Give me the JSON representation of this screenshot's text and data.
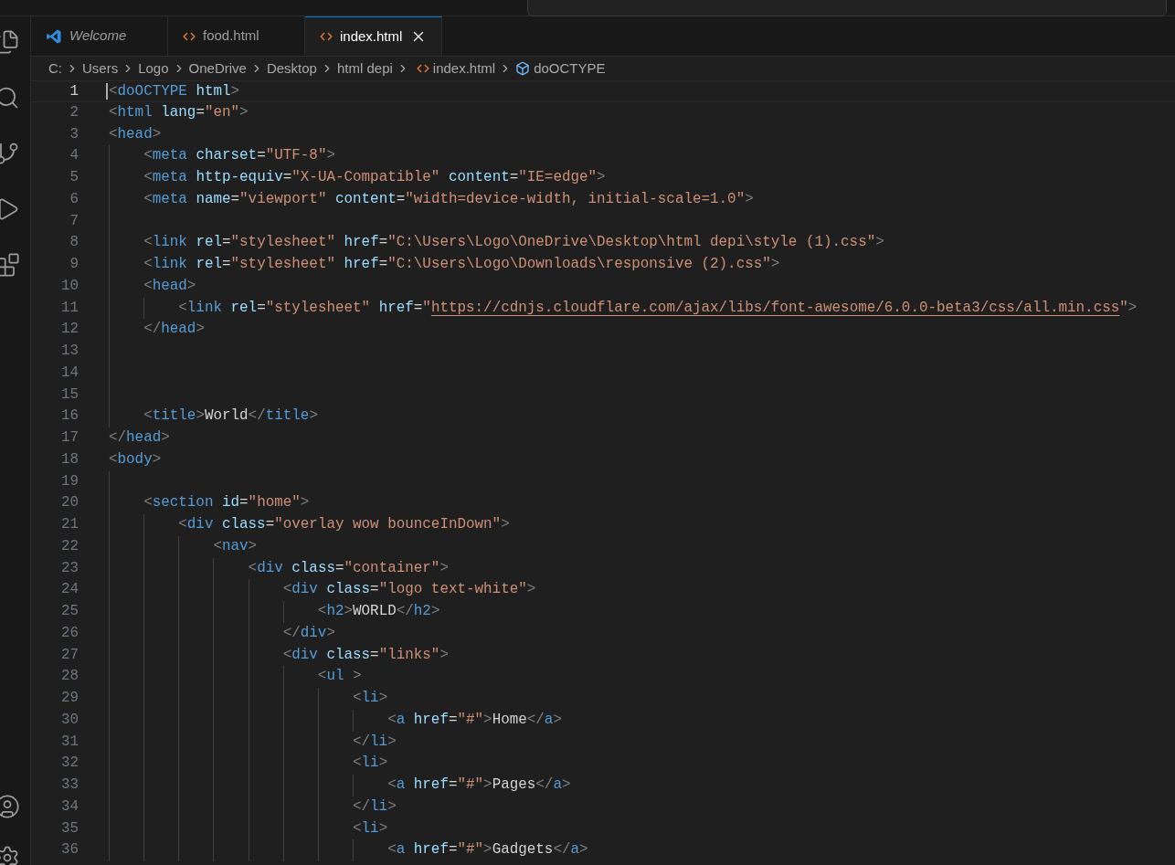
{
  "tabs": [
    {
      "label": "Welcome",
      "kind": "welcome",
      "selected": false
    },
    {
      "label": "food.html",
      "kind": "html",
      "selected": false
    },
    {
      "label": "index.html",
      "kind": "html",
      "selected": true
    }
  ],
  "breadcrumbs": [
    {
      "label": "C:",
      "kind": "folder"
    },
    {
      "label": "Users",
      "kind": "folder"
    },
    {
      "label": "Logo",
      "kind": "folder"
    },
    {
      "label": "OneDrive",
      "kind": "folder"
    },
    {
      "label": "Desktop",
      "kind": "folder"
    },
    {
      "label": "html depi",
      "kind": "folder"
    },
    {
      "label": "index.html",
      "kind": "html"
    },
    {
      "label": "doOCTYPE",
      "kind": "symbol"
    }
  ],
  "editor": {
    "lines": [
      {
        "number": "1",
        "current": true,
        "tokens": [
          {
            "kind": "punct",
            "text": "<"
          },
          {
            "kind": "tag",
            "text": "doOCTYPE"
          },
          {
            "kind": "attr",
            "text": " html"
          },
          {
            "kind": "punct",
            "text": ">"
          }
        ]
      },
      {
        "number": "2",
        "current": false,
        "tokens": [
          {
            "kind": "punct",
            "text": "<"
          },
          {
            "kind": "tag",
            "text": "html"
          },
          {
            "kind": "attr",
            "text": " lang"
          },
          {
            "kind": "plain",
            "text": "="
          },
          {
            "kind": "string",
            "text": "\"en\""
          },
          {
            "kind": "punct",
            "text": ">"
          }
        ]
      },
      {
        "number": "3",
        "current": false,
        "tokens": [
          {
            "kind": "punct",
            "text": "<"
          },
          {
            "kind": "tag",
            "text": "head"
          },
          {
            "kind": "punct",
            "text": ">"
          }
        ]
      },
      {
        "number": "4",
        "current": false,
        "tokens": [
          {
            "kind": "punct",
            "text": "    <"
          },
          {
            "kind": "tag",
            "text": "meta"
          },
          {
            "kind": "attr",
            "text": " charset"
          },
          {
            "kind": "plain",
            "text": "="
          },
          {
            "kind": "string",
            "text": "\"UTF-8\""
          },
          {
            "kind": "punct",
            "text": ">"
          }
        ]
      },
      {
        "number": "5",
        "current": false,
        "tokens": [
          {
            "kind": "punct",
            "text": "    <"
          },
          {
            "kind": "tag",
            "text": "meta"
          },
          {
            "kind": "attr",
            "text": " http-equiv"
          },
          {
            "kind": "plain",
            "text": "="
          },
          {
            "kind": "string",
            "text": "\"X-UA-Compatible\""
          },
          {
            "kind": "attr",
            "text": " content"
          },
          {
            "kind": "plain",
            "text": "="
          },
          {
            "kind": "string",
            "text": "\"IE=edge\""
          },
          {
            "kind": "punct",
            "text": ">"
          }
        ]
      },
      {
        "number": "6",
        "current": false,
        "tokens": [
          {
            "kind": "punct",
            "text": "    <"
          },
          {
            "kind": "tag",
            "text": "meta"
          },
          {
            "kind": "attr",
            "text": " name"
          },
          {
            "kind": "plain",
            "text": "="
          },
          {
            "kind": "string",
            "text": "\"viewport\""
          },
          {
            "kind": "attr",
            "text": " content"
          },
          {
            "kind": "plain",
            "text": "="
          },
          {
            "kind": "string",
            "text": "\"width=device-width, initial-scale=1.0\""
          },
          {
            "kind": "punct",
            "text": ">"
          }
        ]
      },
      {
        "number": "7",
        "current": false
      },
      {
        "number": "8",
        "current": false,
        "tokens": [
          {
            "kind": "punct",
            "text": "    <"
          },
          {
            "kind": "tag",
            "text": "link"
          },
          {
            "kind": "attr",
            "text": " rel"
          },
          {
            "kind": "plain",
            "text": "="
          },
          {
            "kind": "string",
            "text": "\"stylesheet\""
          },
          {
            "kind": "attr",
            "text": " href"
          },
          {
            "kind": "plain",
            "text": "="
          },
          {
            "kind": "string",
            "text": "\"C:\\Users\\Logo\\OneDrive\\Desktop\\html depi\\style (1).css\""
          },
          {
            "kind": "punct",
            "text": ">"
          }
        ]
      },
      {
        "number": "9",
        "current": false,
        "tokens": [
          {
            "kind": "punct",
            "text": "    <"
          },
          {
            "kind": "tag",
            "text": "link"
          },
          {
            "kind": "attr",
            "text": " rel"
          },
          {
            "kind": "plain",
            "text": "="
          },
          {
            "kind": "string",
            "text": "\"stylesheet\""
          },
          {
            "kind": "attr",
            "text": " href"
          },
          {
            "kind": "plain",
            "text": "="
          },
          {
            "kind": "string",
            "text": "\"C:\\Users\\Logo\\Downloads\\responsive (2).css\""
          },
          {
            "kind": "punct",
            "text": ">"
          }
        ]
      },
      {
        "number": "10",
        "current": false,
        "tokens": [
          {
            "kind": "punct",
            "text": "    <"
          },
          {
            "kind": "tag",
            "text": "head"
          },
          {
            "kind": "punct",
            "text": ">"
          }
        ]
      },
      {
        "number": "11",
        "current": false,
        "tokens": [
          {
            "kind": "punct",
            "text": "        <"
          },
          {
            "kind": "tag",
            "text": "link"
          },
          {
            "kind": "attr",
            "text": " rel"
          },
          {
            "kind": "plain",
            "text": "="
          },
          {
            "kind": "string",
            "text": "\"stylesheet\""
          },
          {
            "kind": "attr",
            "text": " href"
          },
          {
            "kind": "plain",
            "text": "="
          },
          {
            "kind": "string",
            "text": "\""
          },
          {
            "kind": "url",
            "text": "https://cdnjs.cloudflare.com/ajax/libs/font-awesome/6.0.0-beta3/css/all.min.css"
          },
          {
            "kind": "string",
            "text": "\""
          },
          {
            "kind": "punct",
            "text": ">"
          }
        ]
      },
      {
        "number": "12",
        "current": false,
        "tokens": [
          {
            "kind": "punct",
            "text": "    </"
          },
          {
            "kind": "tag",
            "text": "head"
          },
          {
            "kind": "punct",
            "text": ">"
          }
        ]
      },
      {
        "number": "13",
        "current": false
      },
      {
        "number": "14",
        "current": false
      },
      {
        "number": "15",
        "current": false
      },
      {
        "number": "16",
        "current": false,
        "tokens": [
          {
            "kind": "punct",
            "text": "    <"
          },
          {
            "kind": "tag",
            "text": "title"
          },
          {
            "kind": "punct",
            "text": ">"
          },
          {
            "kind": "plain",
            "text": "World"
          },
          {
            "kind": "punct",
            "text": "</"
          },
          {
            "kind": "tag",
            "text": "title"
          },
          {
            "kind": "punct",
            "text": ">"
          }
        ]
      },
      {
        "number": "17",
        "current": false,
        "tokens": [
          {
            "kind": "punct",
            "text": "</"
          },
          {
            "kind": "tag",
            "text": "head"
          },
          {
            "kind": "punct",
            "text": ">"
          }
        ]
      },
      {
        "number": "18",
        "current": false,
        "tokens": [
          {
            "kind": "punct",
            "text": "<"
          },
          {
            "kind": "tag",
            "text": "body"
          },
          {
            "kind": "punct",
            "text": ">"
          }
        ]
      },
      {
        "number": "19",
        "current": false
      },
      {
        "number": "20",
        "current": false,
        "tokens": [
          {
            "kind": "punct",
            "text": "    <"
          },
          {
            "kind": "tag",
            "text": "section"
          },
          {
            "kind": "attr",
            "text": " id"
          },
          {
            "kind": "plain",
            "text": "="
          },
          {
            "kind": "string",
            "text": "\"home\""
          },
          {
            "kind": "punct",
            "text": ">"
          }
        ]
      },
      {
        "number": "21",
        "current": false,
        "tokens": [
          {
            "kind": "punct",
            "text": "        <"
          },
          {
            "kind": "tag",
            "text": "div"
          },
          {
            "kind": "attr",
            "text": " class"
          },
          {
            "kind": "plain",
            "text": "="
          },
          {
            "kind": "string",
            "text": "\"overlay wow bounceInDown\""
          },
          {
            "kind": "punct",
            "text": ">"
          }
        ]
      },
      {
        "number": "22",
        "current": false,
        "tokens": [
          {
            "kind": "punct",
            "text": "            <"
          },
          {
            "kind": "tag",
            "text": "nav"
          },
          {
            "kind": "punct",
            "text": ">"
          }
        ]
      },
      {
        "number": "23",
        "current": false,
        "tokens": [
          {
            "kind": "punct",
            "text": "                <"
          },
          {
            "kind": "tag",
            "text": "div"
          },
          {
            "kind": "attr",
            "text": " class"
          },
          {
            "kind": "plain",
            "text": "="
          },
          {
            "kind": "string",
            "text": "\"container\""
          },
          {
            "kind": "punct",
            "text": ">"
          }
        ]
      },
      {
        "number": "24",
        "current": false,
        "tokens": [
          {
            "kind": "punct",
            "text": "                    <"
          },
          {
            "kind": "tag",
            "text": "div"
          },
          {
            "kind": "attr",
            "text": " class"
          },
          {
            "kind": "plain",
            "text": "="
          },
          {
            "kind": "string",
            "text": "\"logo text-white\""
          },
          {
            "kind": "punct",
            "text": ">"
          }
        ]
      },
      {
        "number": "25",
        "current": false,
        "tokens": [
          {
            "kind": "punct",
            "text": "                        <"
          },
          {
            "kind": "tag",
            "text": "h2"
          },
          {
            "kind": "punct",
            "text": ">"
          },
          {
            "kind": "plain",
            "text": "WORLD"
          },
          {
            "kind": "punct",
            "text": "</"
          },
          {
            "kind": "tag",
            "text": "h2"
          },
          {
            "kind": "punct",
            "text": ">"
          }
        ]
      },
      {
        "number": "26",
        "current": false,
        "tokens": [
          {
            "kind": "punct",
            "text": "                    </"
          },
          {
            "kind": "tag",
            "text": "div"
          },
          {
            "kind": "punct",
            "text": ">"
          }
        ]
      },
      {
        "number": "27",
        "current": false,
        "tokens": [
          {
            "kind": "punct",
            "text": "                    <"
          },
          {
            "kind": "tag",
            "text": "div"
          },
          {
            "kind": "attr",
            "text": " class"
          },
          {
            "kind": "plain",
            "text": "="
          },
          {
            "kind": "string",
            "text": "\"links\""
          },
          {
            "kind": "punct",
            "text": ">"
          }
        ]
      },
      {
        "number": "28",
        "current": false,
        "tokens": [
          {
            "kind": "punct",
            "text": "                        <"
          },
          {
            "kind": "tag",
            "text": "ul"
          },
          {
            "kind": "punct",
            "text": " >"
          }
        ]
      },
      {
        "number": "29",
        "current": false,
        "tokens": [
          {
            "kind": "punct",
            "text": "                            <"
          },
          {
            "kind": "tag",
            "text": "li"
          },
          {
            "kind": "punct",
            "text": ">"
          }
        ]
      },
      {
        "number": "30",
        "current": false,
        "tokens": [
          {
            "kind": "punct",
            "text": "                                <"
          },
          {
            "kind": "tag",
            "text": "a"
          },
          {
            "kind": "attr",
            "text": " href"
          },
          {
            "kind": "plain",
            "text": "="
          },
          {
            "kind": "string",
            "text": "\"#\""
          },
          {
            "kind": "punct",
            "text": ">"
          },
          {
            "kind": "plain",
            "text": "Home"
          },
          {
            "kind": "punct",
            "text": "</"
          },
          {
            "kind": "tag",
            "text": "a"
          },
          {
            "kind": "punct",
            "text": ">"
          }
        ]
      },
      {
        "number": "31",
        "current": false,
        "tokens": [
          {
            "kind": "punct",
            "text": "                            </"
          },
          {
            "kind": "tag",
            "text": "li"
          },
          {
            "kind": "punct",
            "text": ">"
          }
        ]
      },
      {
        "number": "32",
        "current": false,
        "tokens": [
          {
            "kind": "punct",
            "text": "                            <"
          },
          {
            "kind": "tag",
            "text": "li"
          },
          {
            "kind": "punct",
            "text": ">"
          }
        ]
      },
      {
        "number": "33",
        "current": false,
        "tokens": [
          {
            "kind": "punct",
            "text": "                                <"
          },
          {
            "kind": "tag",
            "text": "a"
          },
          {
            "kind": "attr",
            "text": " href"
          },
          {
            "kind": "plain",
            "text": "="
          },
          {
            "kind": "string",
            "text": "\"#\""
          },
          {
            "kind": "punct",
            "text": ">"
          },
          {
            "kind": "plain",
            "text": "Pages"
          },
          {
            "kind": "punct",
            "text": "</"
          },
          {
            "kind": "tag",
            "text": "a"
          },
          {
            "kind": "punct",
            "text": ">"
          }
        ]
      },
      {
        "number": "34",
        "current": false,
        "tokens": [
          {
            "kind": "punct",
            "text": "                            </"
          },
          {
            "kind": "tag",
            "text": "li"
          },
          {
            "kind": "punct",
            "text": ">"
          }
        ]
      },
      {
        "number": "35",
        "current": false,
        "tokens": [
          {
            "kind": "punct",
            "text": "                            <"
          },
          {
            "kind": "tag",
            "text": "li"
          },
          {
            "kind": "punct",
            "text": ">"
          }
        ]
      },
      {
        "number": "36",
        "current": false,
        "tokens": [
          {
            "kind": "punct",
            "text": "                                <"
          },
          {
            "kind": "tag",
            "text": "a"
          },
          {
            "kind": "attr",
            "text": " href"
          },
          {
            "kind": "plain",
            "text": "="
          },
          {
            "kind": "string",
            "text": "\"#\""
          },
          {
            "kind": "punct",
            "text": ">"
          },
          {
            "kind": "plain",
            "text": "Gadgets"
          },
          {
            "kind": "punct",
            "text": "</"
          },
          {
            "kind": "tag",
            "text": "a"
          },
          {
            "kind": "punct",
            "text": ">"
          }
        ]
      }
    ]
  }
}
